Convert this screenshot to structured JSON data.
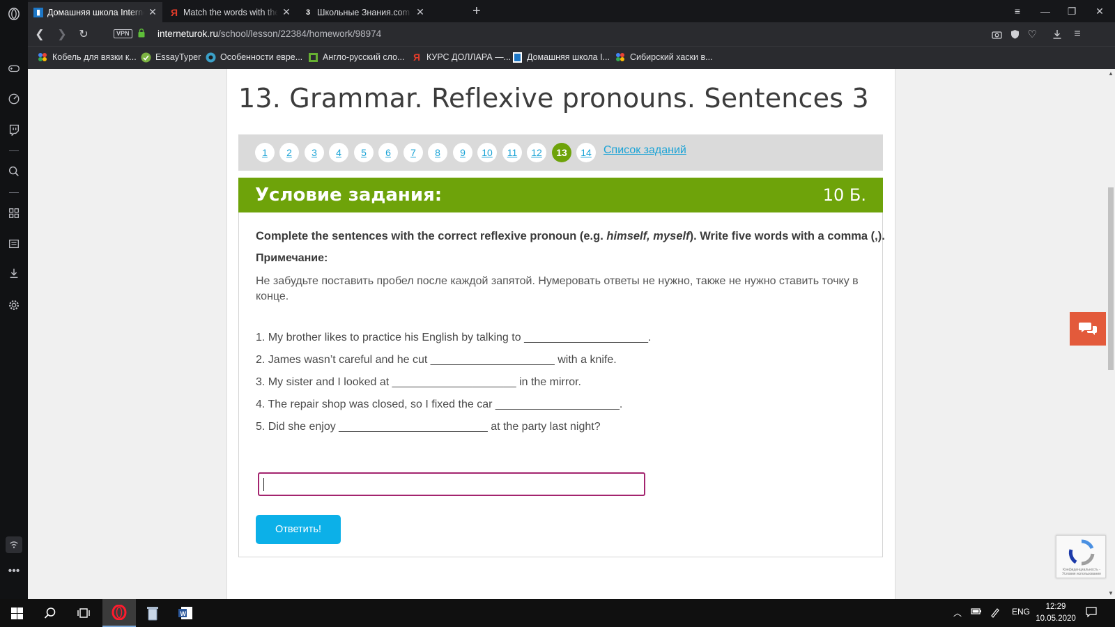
{
  "tabs": [
    {
      "title": "Домашняя школа InternetUrok",
      "active": true,
      "favicon": "internetUrok-icon"
    },
    {
      "title": "Match the words with the translation",
      "active": false,
      "favicon": "yandex-icon"
    },
    {
      "title": "Школьные Знания.com - Помощь",
      "active": false,
      "favicon": "znanija-icon"
    }
  ],
  "address": {
    "vpn_label": "VPN",
    "url_domain": "interneturok.ru",
    "url_path": "/school/lesson/22384/homework/98974"
  },
  "bookmarks": [
    {
      "label": "Кобель для вязки к...",
      "icon": "dots-icon"
    },
    {
      "label": "EssayTyper",
      "icon": "check-circle-icon"
    },
    {
      "label": "Особенности евре...",
      "icon": "globe-icon"
    },
    {
      "label": "Англо-русский сло...",
      "icon": "square-icon"
    },
    {
      "label": "КУРС ДОЛЛАРА —...",
      "icon": "yandex-icon"
    },
    {
      "label": "Домашняя школа I...",
      "icon": "internetUrok-icon"
    },
    {
      "label": "Сибирский хаски в...",
      "icon": "dots-icon"
    }
  ],
  "lesson": {
    "title": "13. Grammar. Reflexive pronouns. Sentences 3"
  },
  "task_nav": {
    "numbers": [
      "1",
      "2",
      "3",
      "4",
      "5",
      "6",
      "7",
      "8",
      "9",
      "10",
      "11",
      "12",
      "13",
      "14"
    ],
    "current": "13",
    "list_link": "Список заданий"
  },
  "condition": {
    "header": "Условие задания:",
    "points": "10 Б.",
    "instruction_before": "Complete the sentences with the correct reflexive pronoun (e.g. ",
    "instruction_italic": "himself, myself",
    "instruction_after": "). Write five words with a comma (,).",
    "note_label": "Примечание:",
    "note_text": "Не забудьте поставить пробел после каждой запятой. Нумеровать ответы не нужно, также не нужно ставить точку в конце.",
    "sentences": [
      "1. My brother likes to practice his English by talking to ____________________.",
      "2. James wasn’t careful and he cut ____________________ with a knife.",
      "3. My sister and I looked at ____________________ in the mirror.",
      "4. The repair shop was closed, so I fixed the car ____________________.",
      "5. Did she enjoy ________________________ at the party last night?"
    ],
    "answer_value": "",
    "submit_label": "Ответить!"
  },
  "recaptcha_text": "Конфиденциальность - Условия использования",
  "taskbar": {
    "language": "ENG",
    "time": "12:29",
    "date": "10.05.2020"
  },
  "colors": {
    "accent_green": "#6ea30a",
    "link_blue": "#1aa3d6",
    "button_blue": "#0cb0e8",
    "input_border": "#a3246e",
    "chat_orange": "#e35a3b"
  }
}
